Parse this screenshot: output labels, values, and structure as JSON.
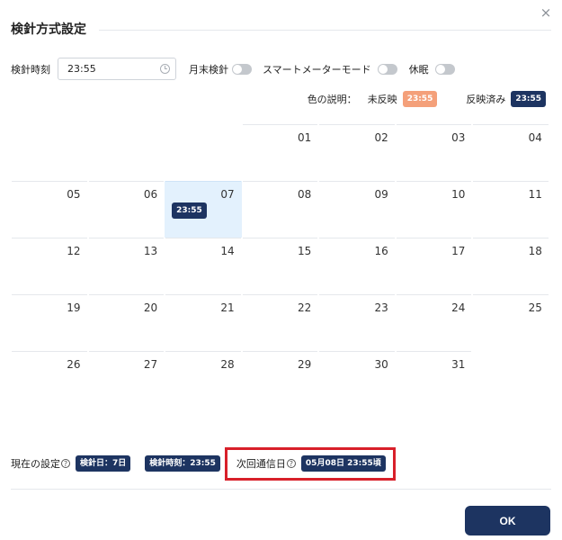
{
  "dialog": {
    "title": "検針方式設定",
    "close_glyph": "×"
  },
  "settings": {
    "time_label": "検針時刻",
    "time_value": "23:55",
    "month_end_label": "月末検針",
    "smart_meter_label": "スマートメーターモード",
    "dormant_label": "休眠"
  },
  "legend": {
    "title": "色の説明：",
    "pending_label": "未反映",
    "pending_time": "23:55",
    "applied_label": "反映済み",
    "applied_time": "23:55"
  },
  "calendar": {
    "rows": [
      [
        "",
        "",
        "",
        "01",
        "02",
        "03",
        "04"
      ],
      [
        "05",
        "06",
        "07",
        "08",
        "09",
        "10",
        "11"
      ],
      [
        "12",
        "13",
        "14",
        "15",
        "16",
        "17",
        "18"
      ],
      [
        "19",
        "20",
        "21",
        "22",
        "23",
        "24",
        "25"
      ],
      [
        "26",
        "27",
        "28",
        "29",
        "30",
        "31",
        ""
      ]
    ],
    "selected_day": "07",
    "selected_badge": "23:55"
  },
  "footer": {
    "current_label": "現在の設定",
    "help_glyph": "?",
    "day_badge": "検針日：7日",
    "time_badge": "検針時刻：23:55",
    "next_label": "次回通信日",
    "next_badge": "05月08日 23:55頃",
    "ok_label": "OK"
  },
  "colors": {
    "accent": "#1d3461",
    "pending": "#f4a07a",
    "selected_cell": "#e3f1fd",
    "highlight": "#d8202a"
  }
}
